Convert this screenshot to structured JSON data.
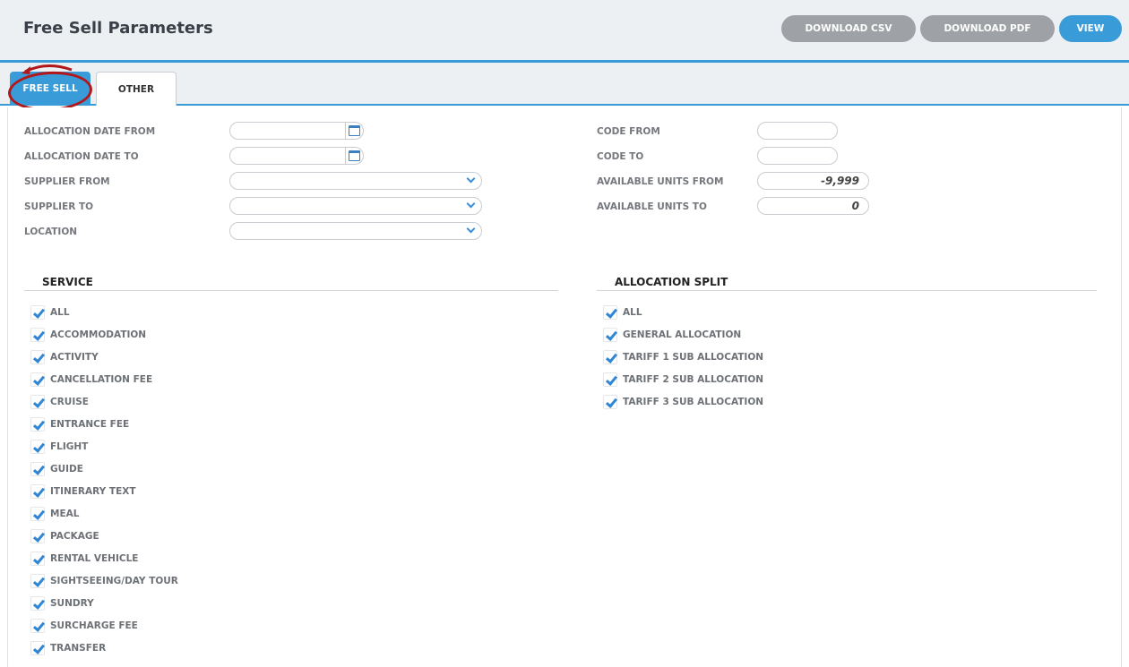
{
  "header": {
    "title": "Free Sell Parameters",
    "download_csv": "DOWNLOAD CSV",
    "download_pdf": "DOWNLOAD PDF",
    "view": "VIEW"
  },
  "tabs": {
    "free_sell": "FREE SELL",
    "other": "OTHER"
  },
  "fields": {
    "allocation_date_from": {
      "label": "ALLOCATION DATE FROM",
      "value": ""
    },
    "allocation_date_to": {
      "label": "ALLOCATION DATE TO",
      "value": ""
    },
    "supplier_from": {
      "label": "SUPPLIER FROM",
      "value": ""
    },
    "supplier_to": {
      "label": "SUPPLIER TO",
      "value": ""
    },
    "location": {
      "label": "LOCATION",
      "value": ""
    },
    "code_from": {
      "label": "CODE FROM",
      "value": ""
    },
    "code_to": {
      "label": "CODE TO",
      "value": ""
    },
    "available_units_from": {
      "label": "AVAILABLE UNITS FROM",
      "value": "-9,999"
    },
    "available_units_to": {
      "label": "AVAILABLE UNITS TO",
      "value": "0"
    }
  },
  "service": {
    "title": "SERVICE",
    "items": [
      "ALL",
      "ACCOMMODATION",
      "ACTIVITY",
      "CANCELLATION FEE",
      "CRUISE",
      "ENTRANCE FEE",
      "FLIGHT",
      "GUIDE",
      "ITINERARY TEXT",
      "MEAL",
      "PACKAGE",
      "RENTAL VEHICLE",
      "SIGHTSEEING/DAY TOUR",
      "SUNDRY",
      "SURCHARGE FEE",
      "TRANSFER"
    ]
  },
  "allocation_split": {
    "title": "ALLOCATION SPLIT",
    "items": [
      "ALL",
      "GENERAL ALLOCATION",
      "TARIFF 1 SUB ALLOCATION",
      "TARIFF 2 SUB ALLOCATION",
      "TARIFF 3 SUB ALLOCATION"
    ]
  },
  "colors": {
    "accent": "#3a9bd9",
    "button_grey": "#9ea1a5",
    "annotation_red": "#b0181b"
  }
}
